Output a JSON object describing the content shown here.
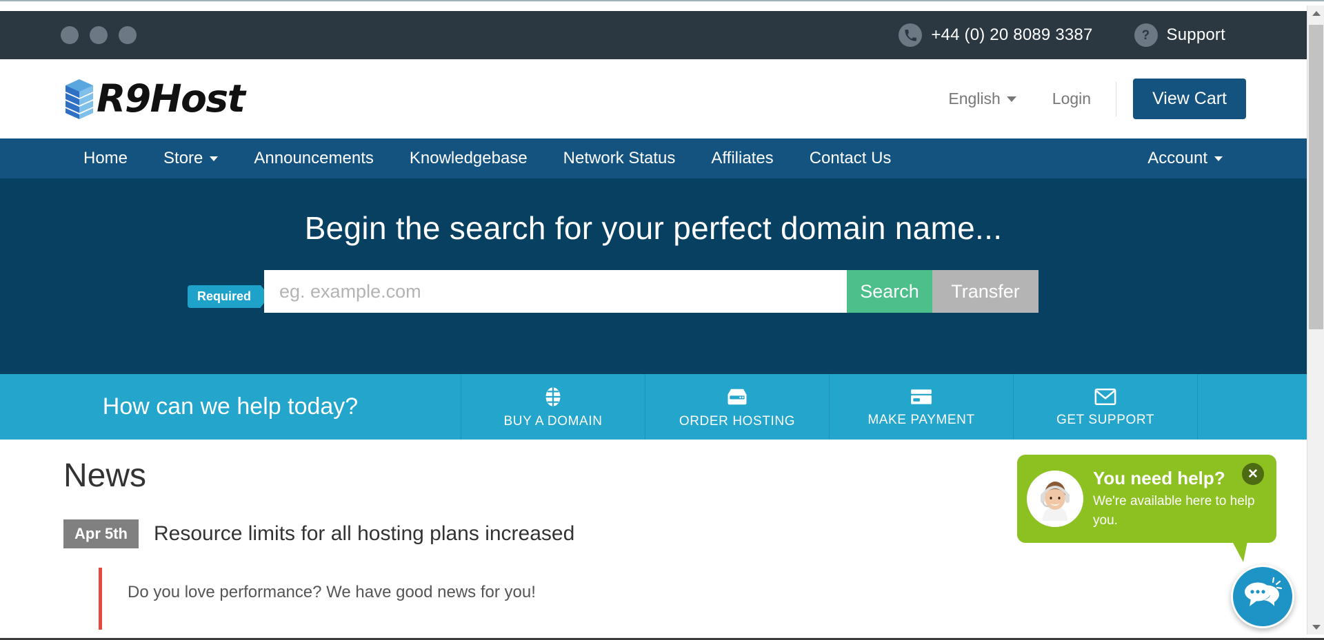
{
  "topbar": {
    "phone": "+44 (0) 20 8089 3387",
    "phone_icon": "phone-icon",
    "support_label": "Support",
    "support_icon": "question-mark-icon",
    "background": "#2b3841",
    "window_dots": [
      "dot-1",
      "dot-2",
      "dot-3"
    ]
  },
  "header": {
    "logo_text": "R9Host",
    "logo_icon": "stacked-server-logo-icon",
    "language": "English",
    "login_label": "Login",
    "cart_label": "View Cart",
    "cart_color": "#14537f"
  },
  "nav": {
    "background": "#14537f",
    "items": [
      {
        "label": "Home",
        "has_caret": false
      },
      {
        "label": "Store",
        "has_caret": true
      },
      {
        "label": "Announcements",
        "has_caret": false
      },
      {
        "label": "Knowledgebase",
        "has_caret": false
      },
      {
        "label": "Network Status",
        "has_caret": false
      },
      {
        "label": "Affiliates",
        "has_caret": false
      },
      {
        "label": "Contact Us",
        "has_caret": false
      }
    ],
    "account_label": "Account"
  },
  "hero": {
    "background": "#084061",
    "title": "Begin the search for your perfect domain name...",
    "required_badge": "Required",
    "required_color": "#1fa2c9",
    "search_placeholder": "eg. example.com",
    "search_value": "",
    "search_button": "Search",
    "search_button_color": "#4cbf8b",
    "transfer_button": "Transfer",
    "transfer_button_color": "#b4b4b4"
  },
  "helpbar": {
    "background": "#23a5cc",
    "title": "How can we help today?",
    "tiles": [
      {
        "label": "BUY A DOMAIN",
        "icon": "globe-icon"
      },
      {
        "label": "ORDER HOSTING",
        "icon": "server-icon"
      },
      {
        "label": "MAKE PAYMENT",
        "icon": "credit-card-icon"
      },
      {
        "label": "GET SUPPORT",
        "icon": "envelope-icon"
      }
    ]
  },
  "news": {
    "section_title": "News",
    "entries": [
      {
        "date": "Apr 5th",
        "headline": "Resource limits for all hosting plans increased",
        "body": "Do you love performance? We have good news for you!",
        "accent_color": "#e8493f"
      }
    ]
  },
  "chat": {
    "heading": "You need help?",
    "subtext": "We're available here to help you.",
    "bubble_color": "#8dc122",
    "close_icon": "close-icon",
    "avatar_icon": "support-agent-avatar",
    "launcher_icon": "chat-bubbles-icon",
    "launcher_color": "#1e93c6"
  },
  "scrollbar": {
    "up_icon": "scroll-up-arrow-icon",
    "down_icon": "scroll-down-arrow-icon"
  }
}
